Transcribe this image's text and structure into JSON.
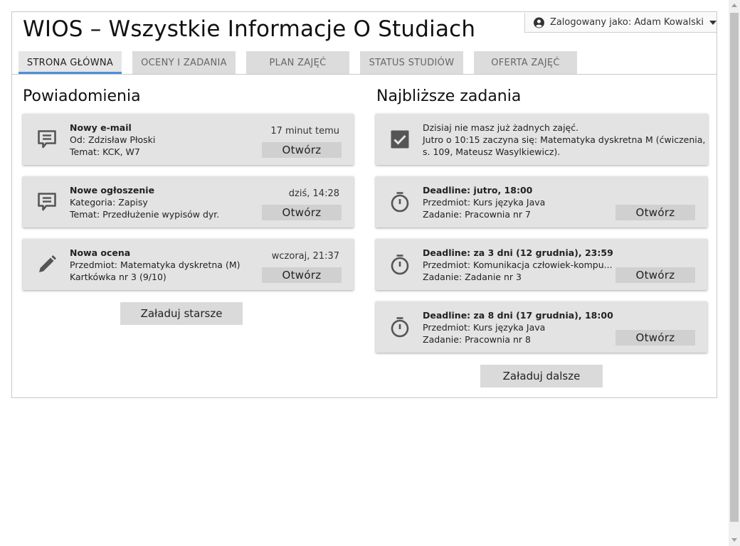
{
  "header": {
    "title": "WIOS – Wszystkie Informacje O Studiach",
    "user_label": "Zalogowany jako: Adam Kowalski",
    "user_icon": "user-circle-icon"
  },
  "tabs": [
    {
      "label": "STRONA GŁÓWNA",
      "active": true
    },
    {
      "label": "OCENY I ZADANIA",
      "active": false
    },
    {
      "label": "PLAN ZAJĘĆ",
      "active": false
    },
    {
      "label": "STATUS STUDIÓW",
      "active": false
    },
    {
      "label": "OFERTA ZAJĘĆ",
      "active": false
    }
  ],
  "notifications": {
    "title": "Powiadomienia",
    "items": [
      {
        "icon": "message-icon",
        "title": "Nowy e-mail",
        "line2": "Od: Zdzisław Płoski",
        "line3": "Temat: KCK, W7",
        "time": "17 minut temu",
        "button": "Otwórz"
      },
      {
        "icon": "message-icon",
        "title": "Nowe ogłoszenie",
        "line2": "Kategoria: Zapisy",
        "line3": "Temat: Przedłużenie wypisów dyr.",
        "time": "dziś, 14:28",
        "button": "Otwórz"
      },
      {
        "icon": "pencil-icon",
        "title": "Nowa ocena",
        "line2": "Przedmiot: Matematyka dyskretna (M)",
        "line3": "Kartkówka nr 3 (9/10)",
        "time": "wczoraj, 21:37",
        "button": "Otwórz"
      }
    ],
    "load_more": "Załaduj starsze"
  },
  "tasks": {
    "title": "Najbliższe zadania",
    "today": {
      "icon": "checkbox-checked-icon",
      "line1": "Dzisiaj nie masz już żadnych zajęć.",
      "line2": "Jutro o 10:15 zaczyna się: Matematyka dyskretna M (ćwiczenia,",
      "line3": "s. 109, Mateusz Wasylkiewicz)."
    },
    "items": [
      {
        "icon": "stopwatch-icon",
        "title": "Deadline: jutro, 18:00",
        "line2": "Przedmiot: Kurs języka Java",
        "line3": "Zadanie: Pracownia nr 7",
        "button": "Otwórz"
      },
      {
        "icon": "stopwatch-icon",
        "title": "Deadline: za 3 dni (12 grudnia), 23:59",
        "line2": "Przedmiot: Komunikacja człowiek-kompu...",
        "line3": "Zadanie: Zadanie nr 3",
        "button": "Otwórz"
      },
      {
        "icon": "stopwatch-icon",
        "title": "Deadline: za 8 dni (17 grudnia), 18:00",
        "line2": "Przedmiot: Kurs języka Java",
        "line3": "Zadanie: Pracownia nr 8",
        "button": "Otwórz"
      }
    ],
    "load_more": "Załaduj dalsze"
  },
  "colors": {
    "accent": "#4a90d9",
    "card": "#e3e3e3",
    "icon": "#555555"
  }
}
